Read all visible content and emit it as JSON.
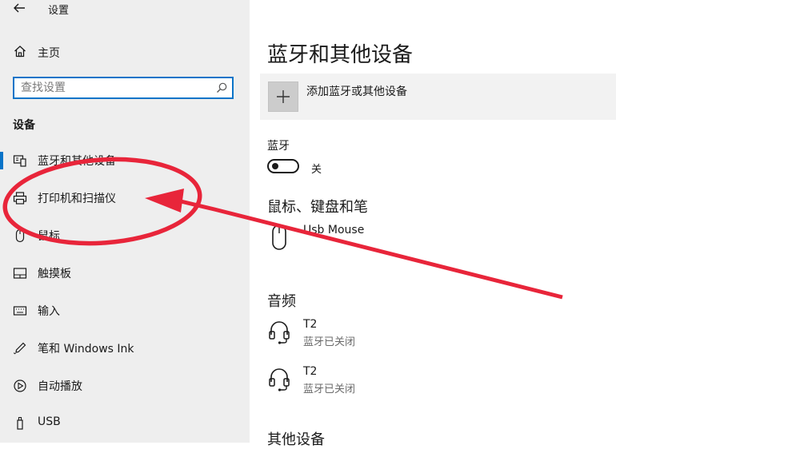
{
  "window": {
    "title": "设置"
  },
  "sidebar": {
    "home_label": "主页",
    "search_placeholder": "查找设置",
    "section_heading": "设备",
    "items": [
      {
        "label": "蓝牙和其他设备",
        "icon": "bluetooth-devices-icon",
        "active": true
      },
      {
        "label": "打印机和扫描仪",
        "icon": "printer-icon",
        "active": false
      },
      {
        "label": "鼠标",
        "icon": "mouse-icon",
        "active": false
      },
      {
        "label": "触摸板",
        "icon": "touchpad-icon",
        "active": false
      },
      {
        "label": "输入",
        "icon": "keyboard-icon",
        "active": false
      },
      {
        "label": "笔和 Windows Ink",
        "icon": "pen-icon",
        "active": false
      },
      {
        "label": "自动播放",
        "icon": "autoplay-icon",
        "active": false
      },
      {
        "label": "USB",
        "icon": "usb-icon",
        "active": false
      }
    ]
  },
  "main": {
    "page_title": "蓝牙和其他设备",
    "add_device_label": "添加蓝牙或其他设备",
    "bluetooth": {
      "heading": "蓝牙",
      "state": "关"
    },
    "mouse_section": {
      "heading": "鼠标、键盘和笔",
      "devices": [
        {
          "name": "Usb Mouse",
          "icon": "mouse-icon"
        }
      ]
    },
    "audio_section": {
      "heading": "音频",
      "devices": [
        {
          "name": "T2",
          "status": "蓝牙已关闭",
          "icon": "headset-icon"
        },
        {
          "name": "T2",
          "status": "蓝牙已关闭",
          "icon": "headset-icon"
        }
      ]
    },
    "other_section": {
      "heading": "其他设备"
    }
  },
  "colors": {
    "accent": "#0a74c8",
    "sidebar_bg": "#eeeeee",
    "annotation": "#e8253a"
  }
}
